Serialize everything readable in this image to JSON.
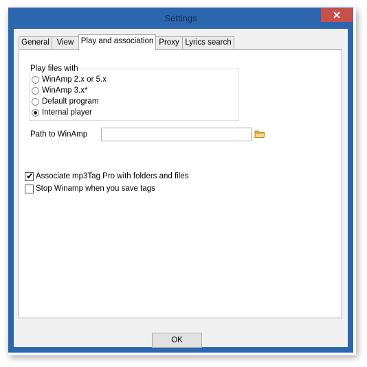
{
  "window": {
    "title": "Settings",
    "close_glyph": "✕"
  },
  "tabs": [
    {
      "label": "General",
      "active": false
    },
    {
      "label": "View",
      "active": false
    },
    {
      "label": "Play and association",
      "active": true
    },
    {
      "label": "Proxy",
      "active": false
    },
    {
      "label": "Lyrics search",
      "active": false
    }
  ],
  "play_group": {
    "label": "Play files with",
    "options": [
      {
        "label": "WinAmp 2.x or 5.x",
        "checked": false
      },
      {
        "label": "WinAmp 3.x*",
        "checked": false
      },
      {
        "label": "Default program",
        "checked": false
      },
      {
        "label": "Internal player",
        "checked": true
      }
    ]
  },
  "path": {
    "label": "Path to WinAmp",
    "value": "",
    "browse_icon": "folder-icon"
  },
  "checkboxes": [
    {
      "label": "Associate mp3Tag Pro with folders and files",
      "checked": true
    },
    {
      "label": "Stop Winamp when you save tags",
      "checked": false
    }
  ],
  "buttons": {
    "ok": "OK"
  },
  "colors": {
    "window_border": "#2c66ae",
    "close_button": "#c7504b",
    "dialog_bg": "#f0f0f0"
  }
}
